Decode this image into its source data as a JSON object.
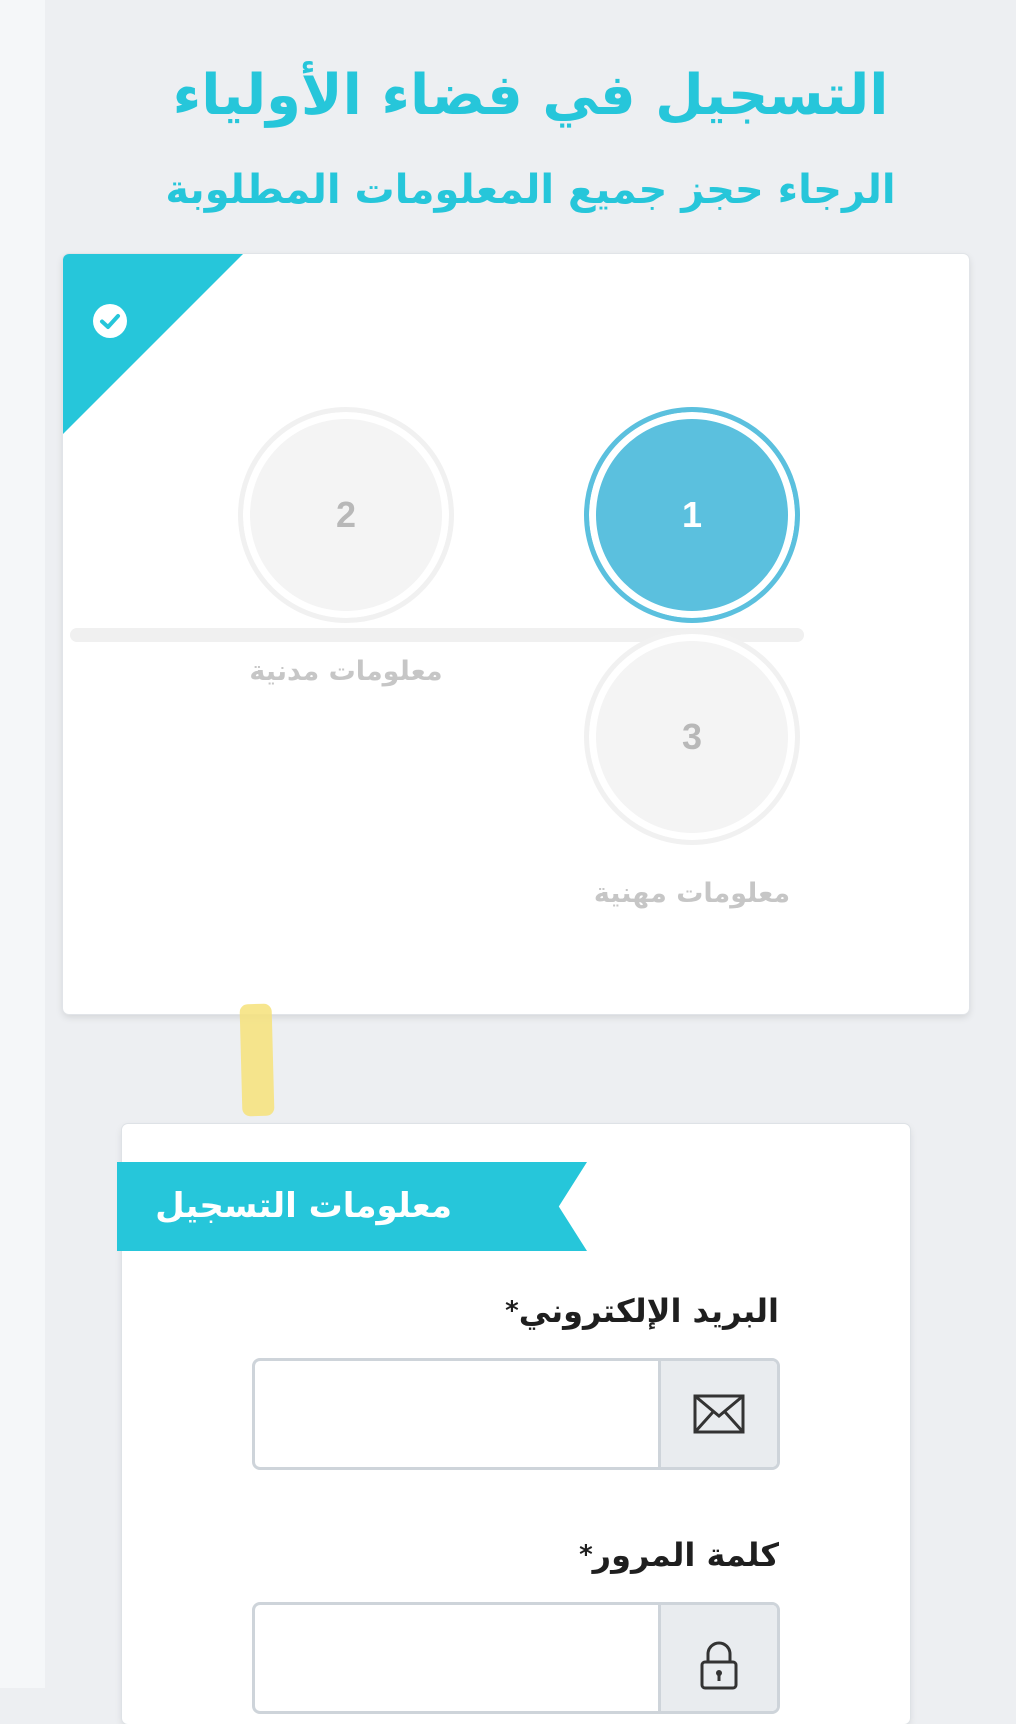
{
  "header": {
    "title": "التسجيل في فضاء الأولياء",
    "subtitle": "الرجاء حجز جميع المعلومات المطلوبة"
  },
  "steps": [
    {
      "number": "1",
      "label": "",
      "state": "active"
    },
    {
      "number": "2",
      "label": "معلومات مدنية",
      "state": "inactive"
    },
    {
      "number": "3",
      "label": "معلومات مهنية",
      "state": "inactive"
    }
  ],
  "form": {
    "section_title": "معلومات التسجيل",
    "email": {
      "label": "البريد الإلكتروني",
      "required_mark": "*",
      "value": "",
      "icon": "envelope-icon"
    },
    "password": {
      "label": "كلمة المرور",
      "required_mark": "*",
      "value": "",
      "icon": "lock-icon"
    }
  },
  "colors": {
    "accent": "#26c6da",
    "step_active": "#5bc0de",
    "step_inactive": "#f4f4f4",
    "highlight": "#f6e27a"
  }
}
